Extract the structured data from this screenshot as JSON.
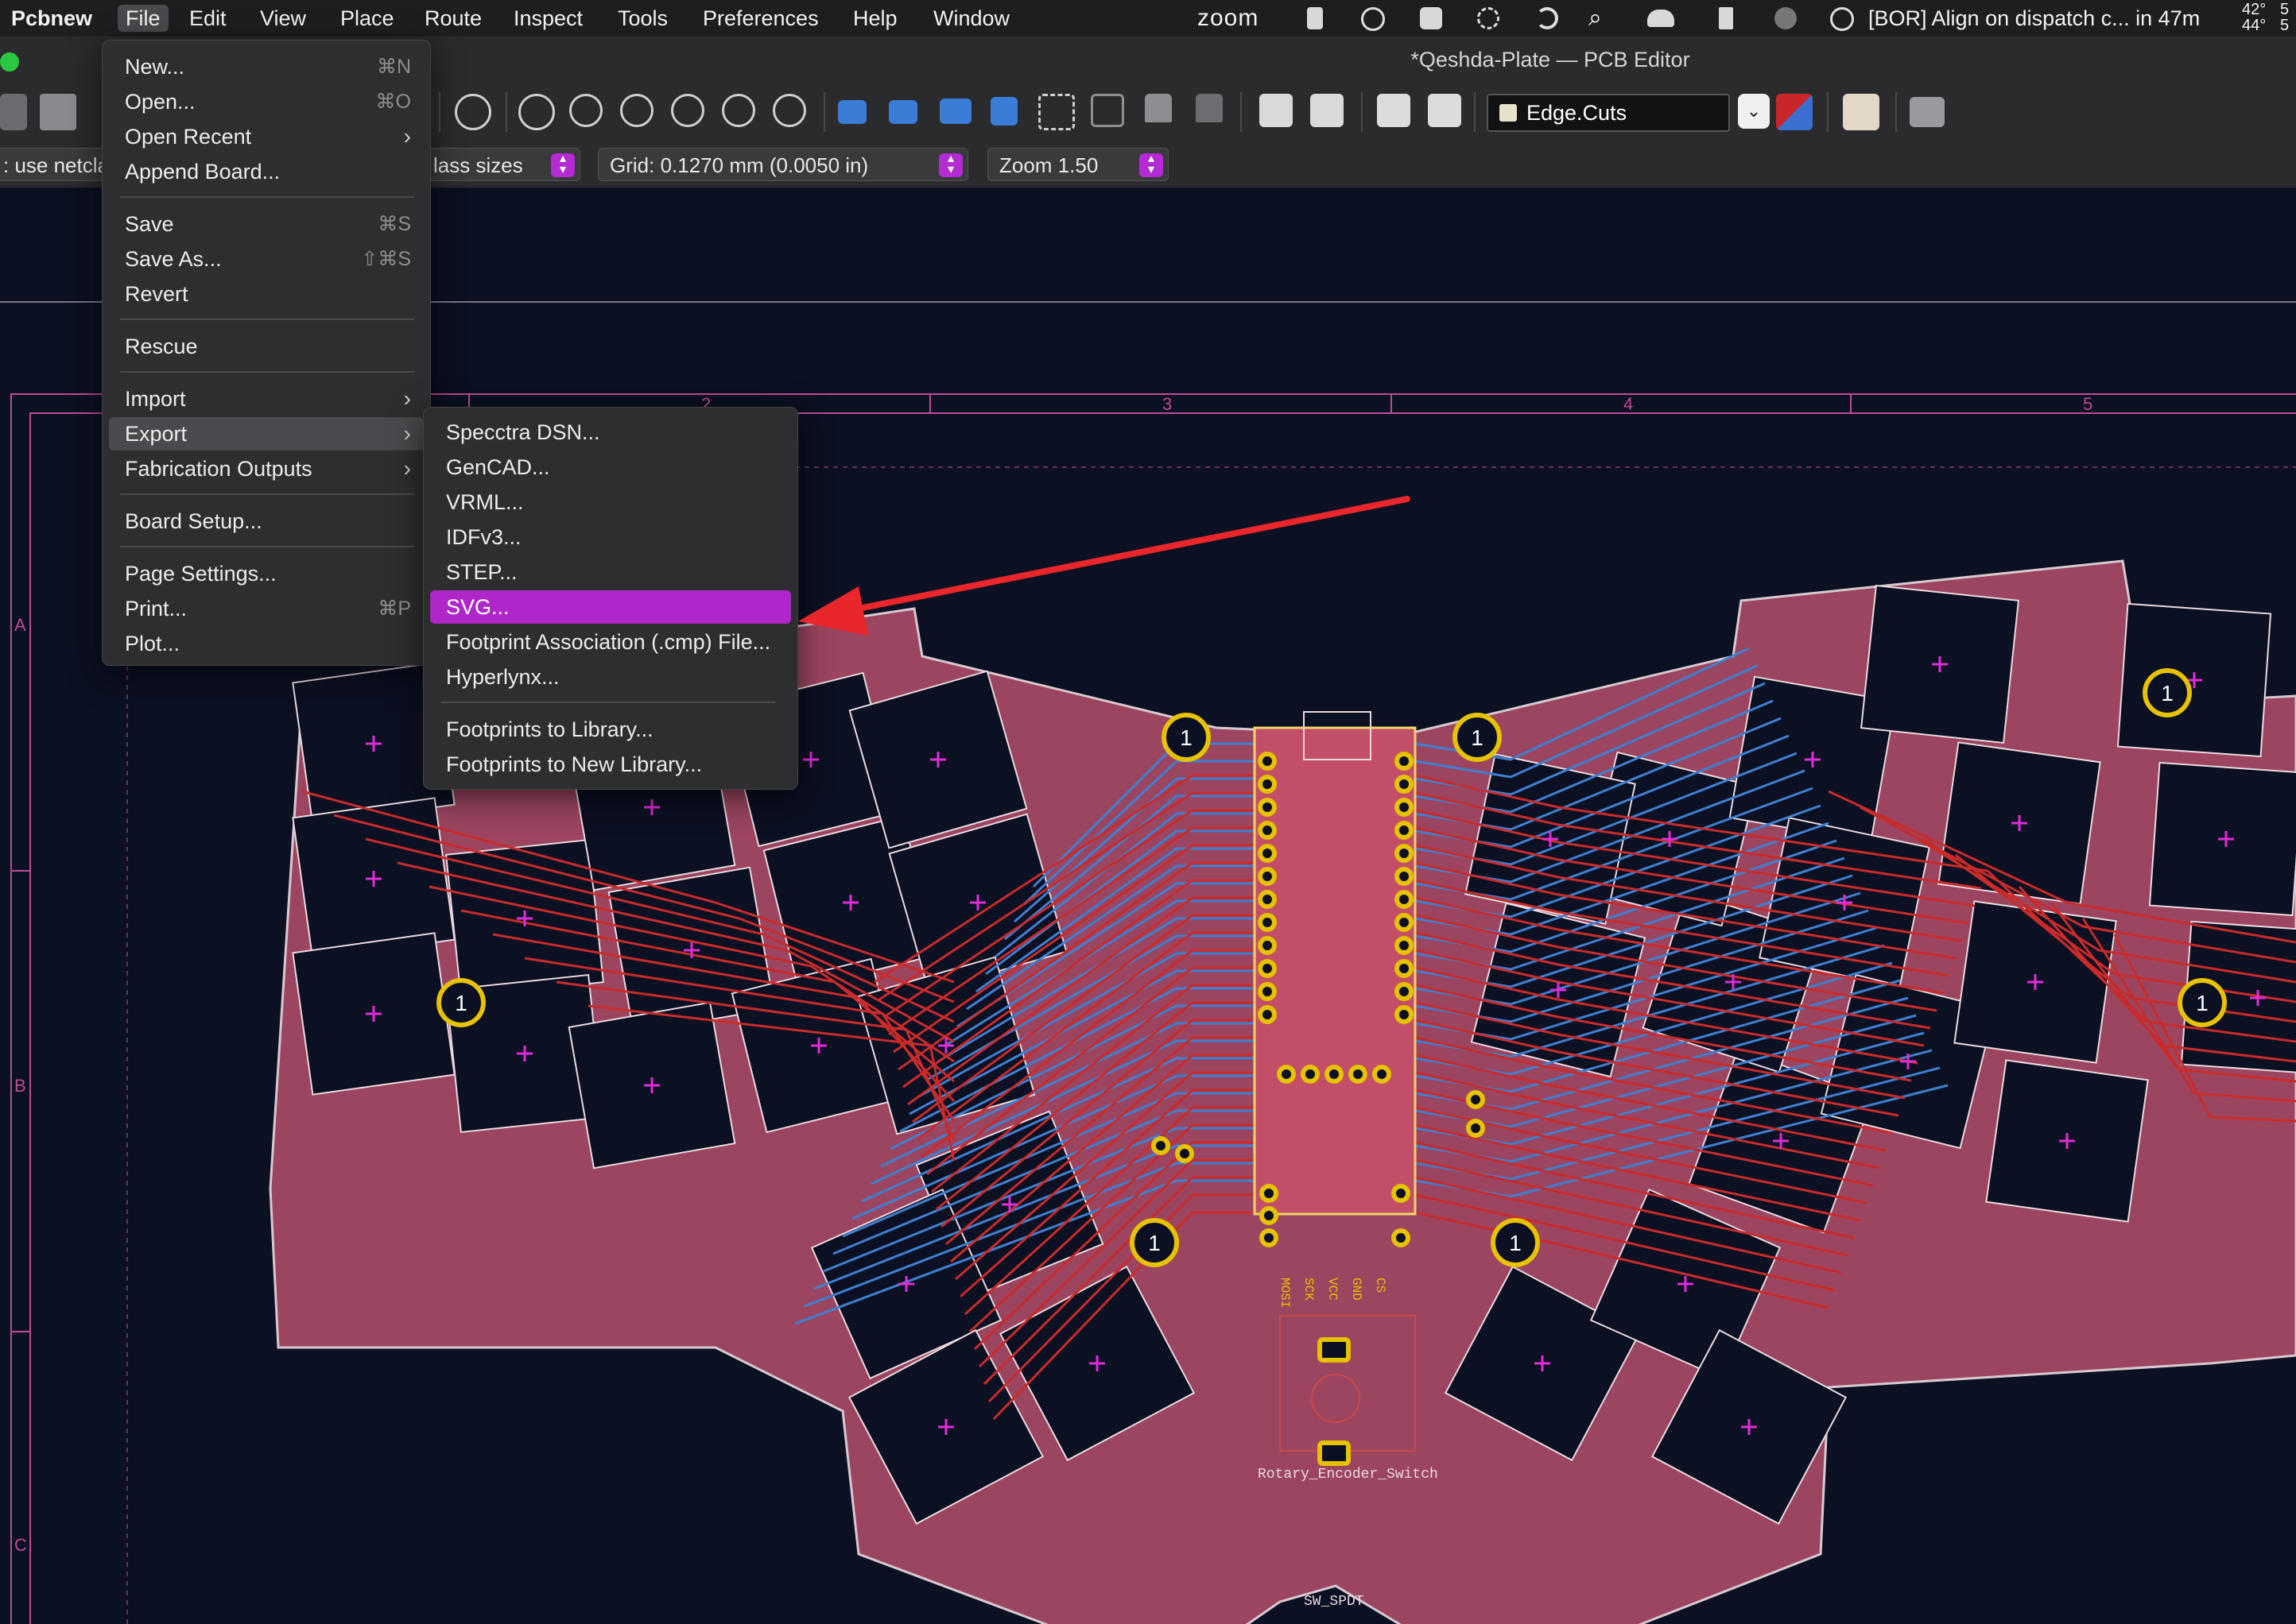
{
  "menubar": {
    "app": "Pcbnew",
    "items": [
      "File",
      "Edit",
      "View",
      "Place",
      "Route",
      "Inspect",
      "Tools",
      "Preferences",
      "Help",
      "Window"
    ],
    "zoom_label": "zoom",
    "event_text": "[BOR] Align on dispatch c... in 47m",
    "temp_top": "42°",
    "temp_bottom": "44°",
    "temp_right_top": "5",
    "temp_right_bottom": "5",
    "tray_icons": [
      "zoom-tray-icon",
      "leaf-icon",
      "airtable-icon",
      "waveform-icon",
      "drone-icon",
      "moon-icon",
      "search-icon",
      "cloud-icon",
      "bookmark-icon",
      "globe-icon",
      "calendar-icon"
    ]
  },
  "window": {
    "title": "*Qeshda-Plate — PCB Editor"
  },
  "toolbar": {
    "active_layer": "Edge.Cuts",
    "layer_swatch_color": "#e7e1c8"
  },
  "toolbar2": {
    "netclass_text": ": use netcla",
    "track_sizes_text": "lass sizes",
    "grid_text": "Grid: 0.1270 mm (0.0050 in)",
    "zoom_text": "Zoom 1.50"
  },
  "canvas": {
    "ruler_numbers": [
      "2",
      "3",
      "4",
      "5"
    ],
    "row_letters": [
      "A",
      "B",
      "C"
    ],
    "mount_hole_label": "1",
    "silk_labels": [
      "Rotary_Encoder_Switch",
      "SW_SPDT"
    ],
    "pin_labels": [
      "MOSI",
      "SCK",
      "VCC",
      "GND",
      "CS"
    ],
    "colors": {
      "background": "#0b1022",
      "board_fill": "#a94a66",
      "copper_front": "#c92b2b",
      "copper_back": "#3f7fd0",
      "pad": "#e5c100",
      "plus_marker": "#e02bd9"
    }
  },
  "file_menu": {
    "items": [
      {
        "label": "New...",
        "shortcut": "⌘N"
      },
      {
        "label": "Open...",
        "shortcut": "⌘O"
      },
      {
        "label": "Open Recent",
        "shortcut": ""
      },
      {
        "label": "Append Board...",
        "shortcut": ""
      },
      {
        "label": "Save",
        "shortcut": "⌘S"
      },
      {
        "label": "Save As...",
        "shortcut": "⇧⌘S"
      },
      {
        "label": "Revert",
        "shortcut": ""
      },
      {
        "label": "Rescue",
        "shortcut": ""
      },
      {
        "label": "Import",
        "shortcut": ""
      },
      {
        "label": "Export",
        "shortcut": ""
      },
      {
        "label": "Fabrication Outputs",
        "shortcut": ""
      },
      {
        "label": "Board Setup...",
        "shortcut": ""
      },
      {
        "label": "Page Settings...",
        "shortcut": ""
      },
      {
        "label": "Print...",
        "shortcut": "⌘P"
      },
      {
        "label": "Plot...",
        "shortcut": ""
      }
    ]
  },
  "export_submenu": {
    "items": [
      "Specctra DSN...",
      "GenCAD...",
      "VRML...",
      "IDFv3...",
      "STEP...",
      "SVG...",
      "Footprint Association (.cmp) File...",
      "Hyperlynx...",
      "Footprints to Library...",
      "Footprints to New Library..."
    ],
    "selected": "SVG...",
    "highlight_color": "#b027c9"
  },
  "annotation": {
    "arrow_color": "#e8262b"
  }
}
